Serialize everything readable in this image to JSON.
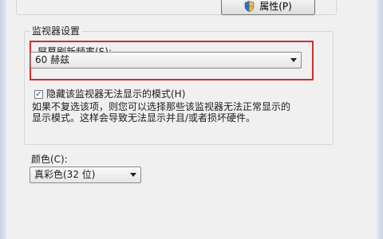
{
  "top": {
    "properties_button_label": "属性(P)"
  },
  "monitor_settings": {
    "group_title": "监视器设置",
    "refresh_rate_label": "屏幕刷新频率(S):",
    "refresh_rate_value": "60 赫兹",
    "hide_modes_checked": true,
    "hide_modes_label": "隐藏该监视器无法显示的模式(H)",
    "description_line1": "如果不复选该项，则您可以选择那些该监视器无法正常显示的",
    "description_line2": "显示模式。这样会导致无法显示并且/或者损坏硬件。"
  },
  "color": {
    "label": "颜色(C):",
    "value": "真彩色(32 位)"
  },
  "colors": {
    "highlight": "#d62b2b",
    "dialog_bg": "#f0f0f0"
  },
  "icons": {
    "properties_button": "uac-shield-icon",
    "checkbox_check": "checkmark-icon",
    "dropdown": "chevron-down-icon"
  }
}
